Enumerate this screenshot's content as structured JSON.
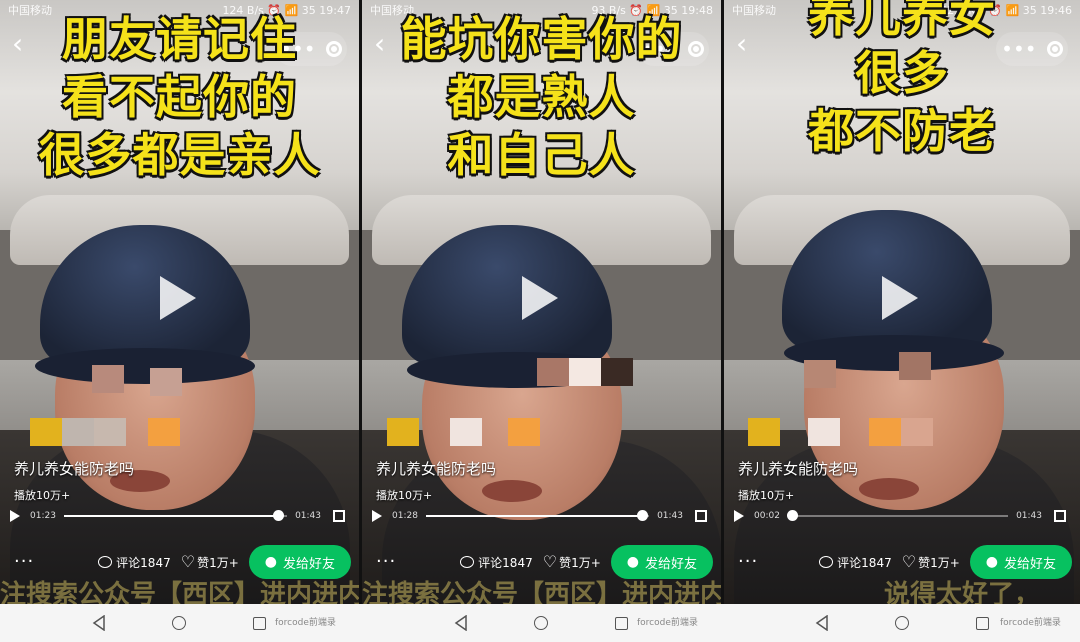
{
  "panels": [
    {
      "status": {
        "carrier": "中国移动",
        "info": "124 B/s ⏰ 📶 35 19:47"
      },
      "caption": [
        "朋友请记住",
        "看不起你的",
        "很多都是亲人"
      ],
      "title": "养儿养女能防老吗",
      "plays": "播放10万+",
      "current_time": "01:23",
      "duration": "01:43",
      "progress": 0.96,
      "comments": "评论1847",
      "likes": "赞1万+",
      "share": "发给好友",
      "bottom_text": "注搜索公众号【西区】进内进内部群，看更多有趣视频）"
    },
    {
      "status": {
        "carrier": "中国移动",
        "info": "93 B/s ⏰ 📶 35 19:48"
      },
      "caption": [
        "能坑你害你的",
        "都是熟人",
        "和自己人"
      ],
      "title": "养儿养女能防老吗",
      "plays": "播放10万+",
      "current_time": "01:28",
      "duration": "01:43",
      "progress": 0.97,
      "comments": "评论1847",
      "likes": "赞1万+",
      "share": "发给好友",
      "bottom_text": "注搜索公众号【西区】进内进内部群，看更多有趣视频）"
    },
    {
      "status": {
        "carrier": "中国移动",
        "info": "52.2 K/s ⏰ 📶 35 19:46"
      },
      "caption": [
        "养儿养女",
        "很多",
        "都不防老"
      ],
      "title": "养儿养女能防老吗",
      "plays": "播放10万+",
      "current_time": "00:02",
      "duration": "01:43",
      "progress": 0.02,
      "comments": "评论1847",
      "likes": "赞1万+",
      "share": "发给好友",
      "bottom_text": "说得太好了，"
    }
  ],
  "watermark": "forcode前端录",
  "icons": {
    "back": "chevron-left-icon",
    "more": "more-dots-icon",
    "target": "target-icon",
    "play": "play-icon",
    "fullscreen": "fullscreen-icon",
    "comment": "comment-icon",
    "like": "heart-icon",
    "wechat": "wechat-icon",
    "nav_back": "nav-back-icon",
    "nav_home": "nav-home-icon",
    "nav_recent": "nav-recent-icon"
  },
  "colors": {
    "caption": "#f5e21a",
    "share_button": "#07c160"
  }
}
